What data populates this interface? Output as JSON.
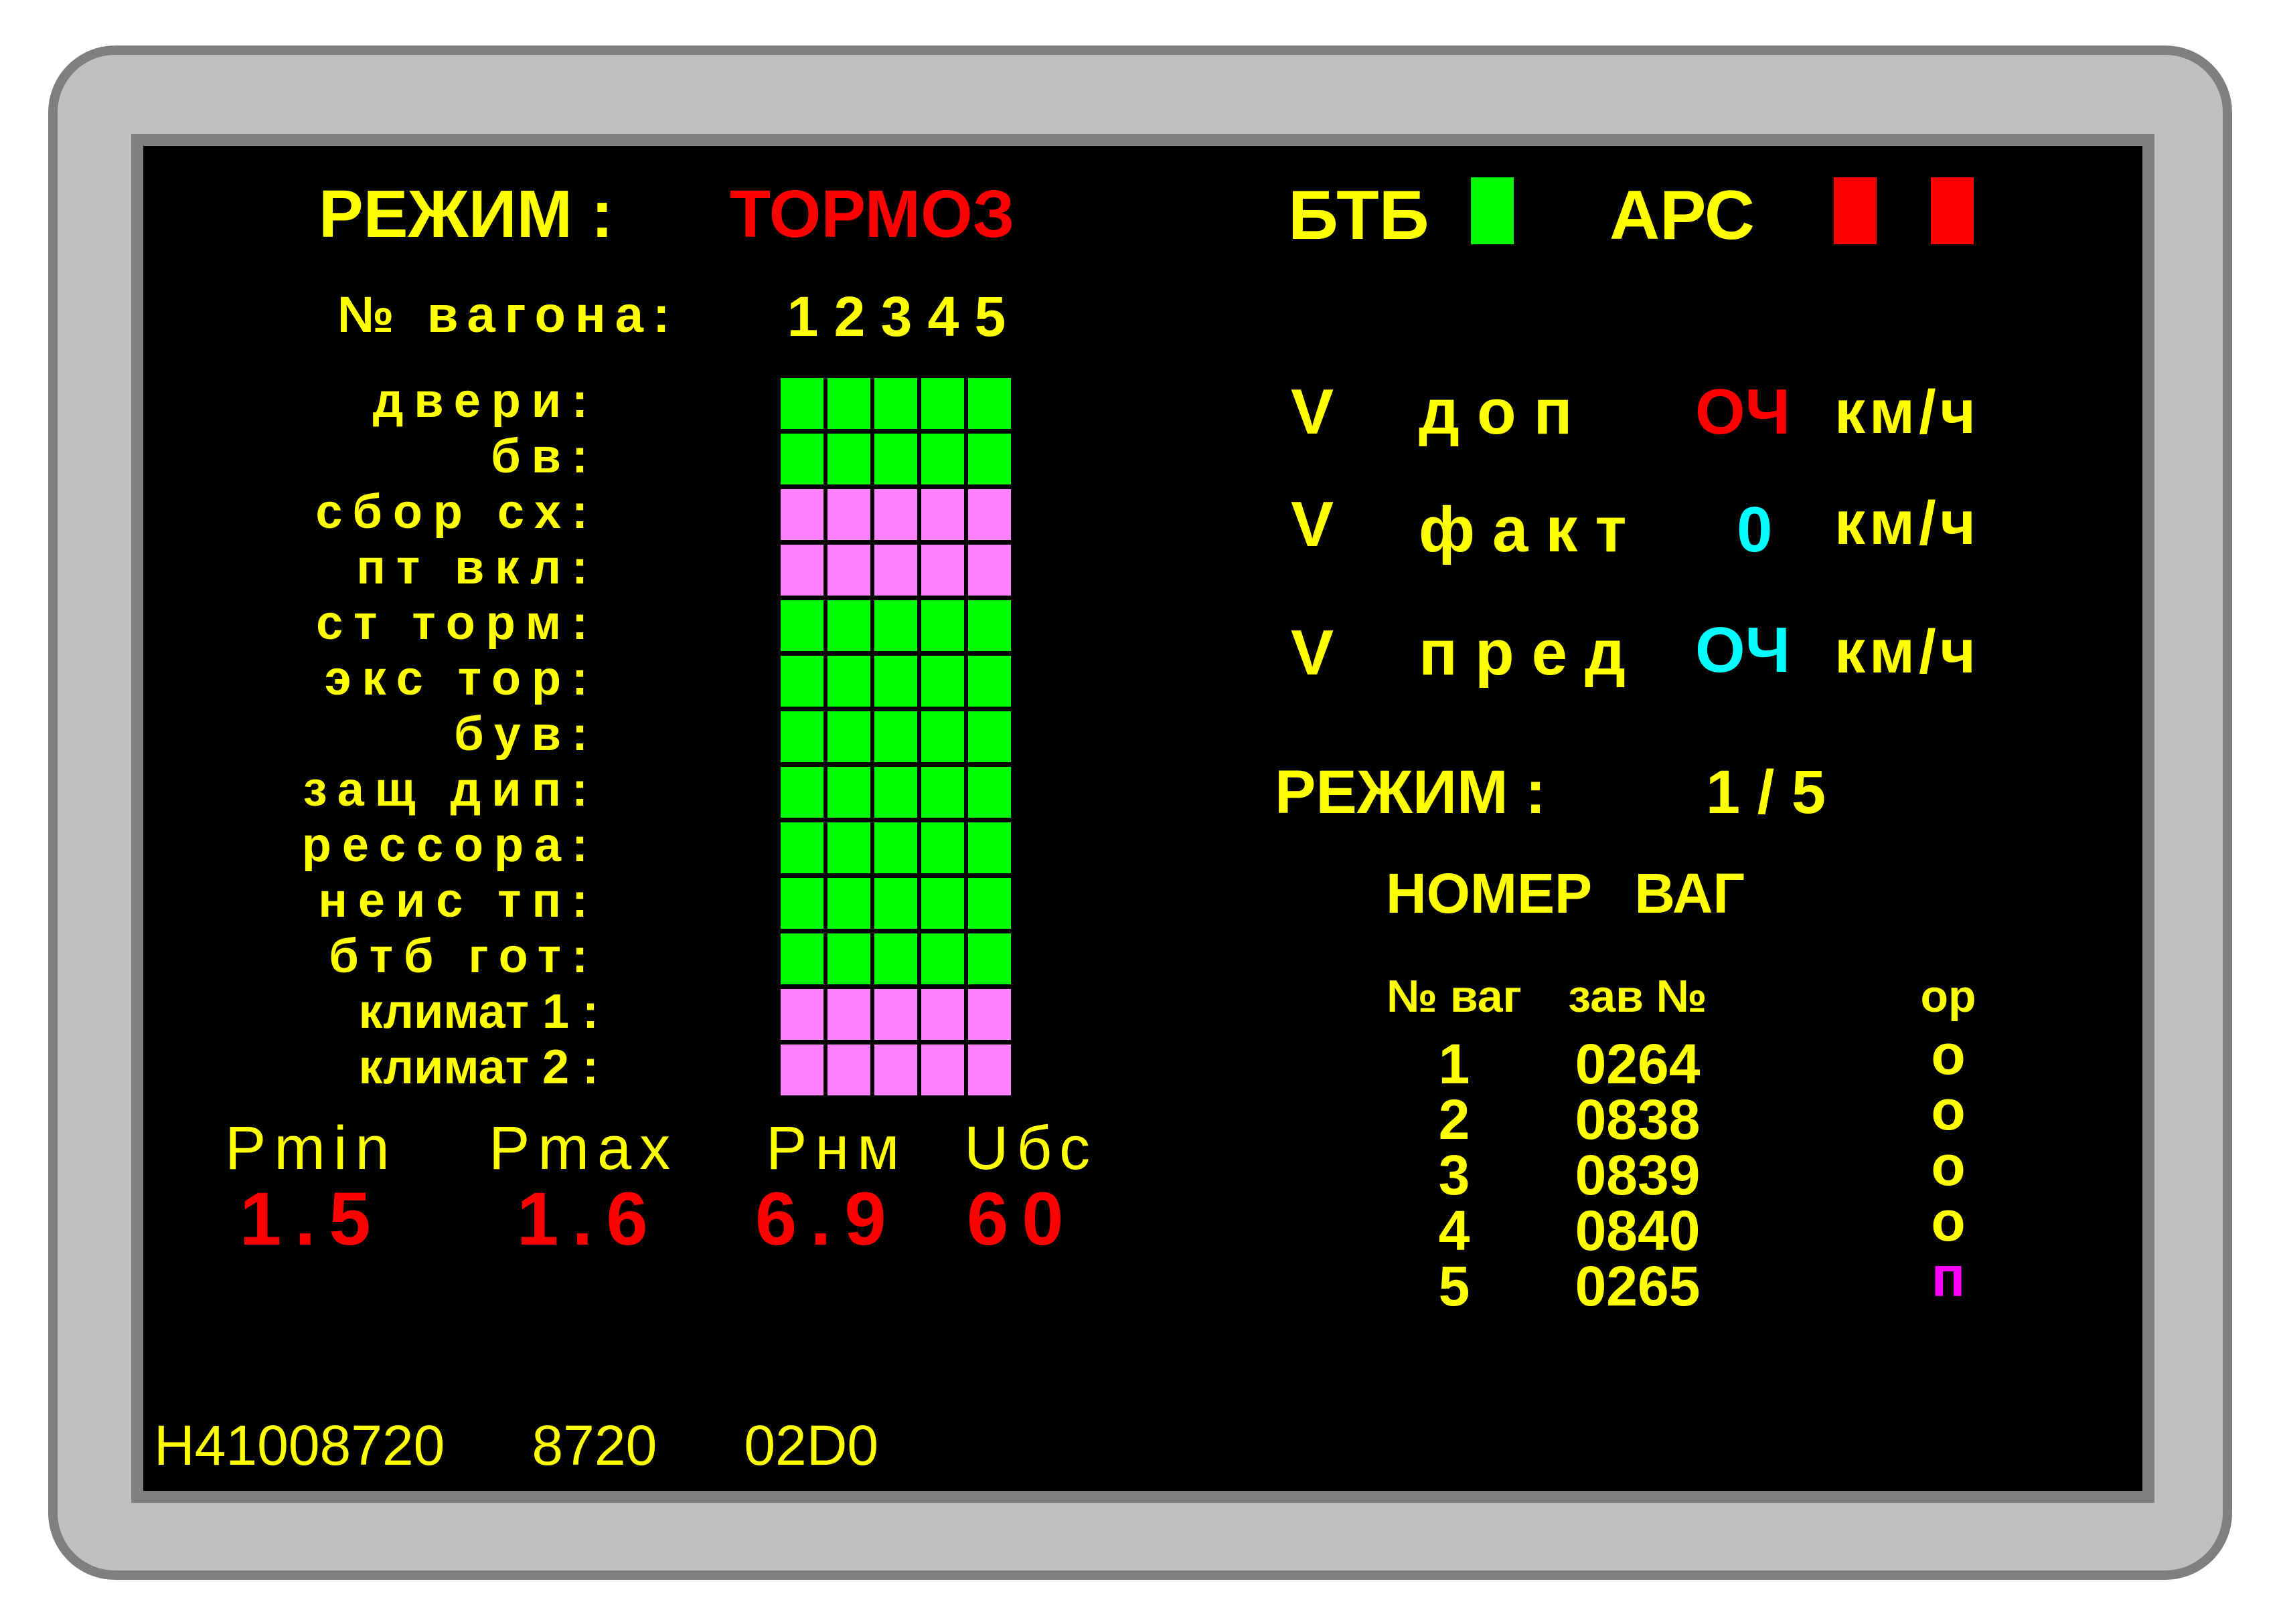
{
  "mode": {
    "title": "РЕЖИМ :",
    "value": "ТОРМОЗ"
  },
  "cars": {
    "label": "№ вагона:",
    "numbers": [
      "1",
      "2",
      "3",
      "4",
      "5"
    ]
  },
  "status_rows": [
    {
      "label": "двери:",
      "color": "#00ff00"
    },
    {
      "label": "бв:",
      "color": "#00ff00"
    },
    {
      "label": "сбор сх:",
      "color": "#ff80ff"
    },
    {
      "label": "пт вкл:",
      "color": "#ff80ff"
    },
    {
      "label": "ст торм:",
      "color": "#00ff00"
    },
    {
      "label": "экс тор:",
      "color": "#00ff00"
    },
    {
      "label": "був:",
      "color": "#00ff00"
    },
    {
      "label": "защ дип:",
      "color": "#00ff00"
    },
    {
      "label": "рессора:",
      "color": "#00ff00"
    },
    {
      "label": "неис тп:",
      "color": "#00ff00"
    },
    {
      "label": "бтб гот:",
      "color": "#00ff00"
    },
    {
      "label": "климат 1 :",
      "color": "#ff80ff"
    },
    {
      "label": "климат 2 :",
      "color": "#ff80ff"
    }
  ],
  "pressure": {
    "labels": [
      "Pmin",
      "Pmax",
      "Pнм",
      "Uбс"
    ],
    "values": [
      "1.5",
      "1.6",
      "6.9",
      "60"
    ]
  },
  "footer": {
    "id": "H41008720",
    "code1": "8720",
    "code2": "02D0"
  },
  "indicators": {
    "btb_label": "БТБ",
    "btb_color": "#00ff00",
    "ars_label": "АРС",
    "ars_colors": [
      "#ff0000",
      "#ff0000"
    ]
  },
  "speeds": [
    {
      "symbol": "V",
      "name": "доп",
      "value": "ОЧ",
      "value_color": "#ff0000",
      "unit": "км/ч"
    },
    {
      "symbol": "V",
      "name": "факт",
      "value": "0",
      "value_color": "#00ffff",
      "unit": "км/ч"
    },
    {
      "symbol": "V",
      "name": "пред",
      "value": "ОЧ",
      "value_color": "#00ffff",
      "unit": "км/ч"
    }
  ],
  "mode2": {
    "title": "РЕЖИМ :",
    "value": "1 / 5"
  },
  "car_table": {
    "title": "НОМЕР ВАГ",
    "headers": [
      "№ ваг",
      "зав №",
      "ор"
    ],
    "rows": [
      {
        "car": "1",
        "serial": "0264",
        "or": "о",
        "or_color": "#ffff00"
      },
      {
        "car": "2",
        "serial": "0838",
        "or": "о",
        "or_color": "#ffff00"
      },
      {
        "car": "3",
        "serial": "0839",
        "or": "о",
        "or_color": "#ffff00"
      },
      {
        "car": "4",
        "serial": "0840",
        "or": "о",
        "or_color": "#ffff00"
      },
      {
        "car": "5",
        "serial": "0265",
        "or": "п",
        "or_color": "#ff00ff"
      }
    ]
  }
}
